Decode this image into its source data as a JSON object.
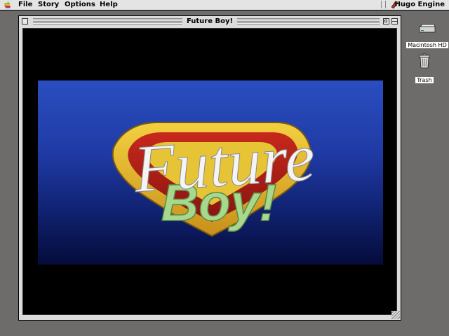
{
  "menubar": {
    "menus": [
      "File",
      "Story",
      "Options",
      "Help"
    ],
    "app_name": "Hugo Engine"
  },
  "desktop": {
    "icons": [
      {
        "label": "Macintosh HD",
        "icon": "hard-drive-icon"
      },
      {
        "label": "Trash",
        "icon": "trash-icon"
      }
    ]
  },
  "window": {
    "title": "Future Boy!",
    "art": {
      "logo_word1": "Future",
      "logo_word2": "Boy!"
    }
  },
  "colors": {
    "desktop": "#6e6c6a",
    "art_blue_top": "#2a4ec0",
    "art_blue_bottom": "#050c3a",
    "shield_red": "#b8231a",
    "shield_gold": "#e0b021",
    "boy_green": "#a8d88c"
  }
}
